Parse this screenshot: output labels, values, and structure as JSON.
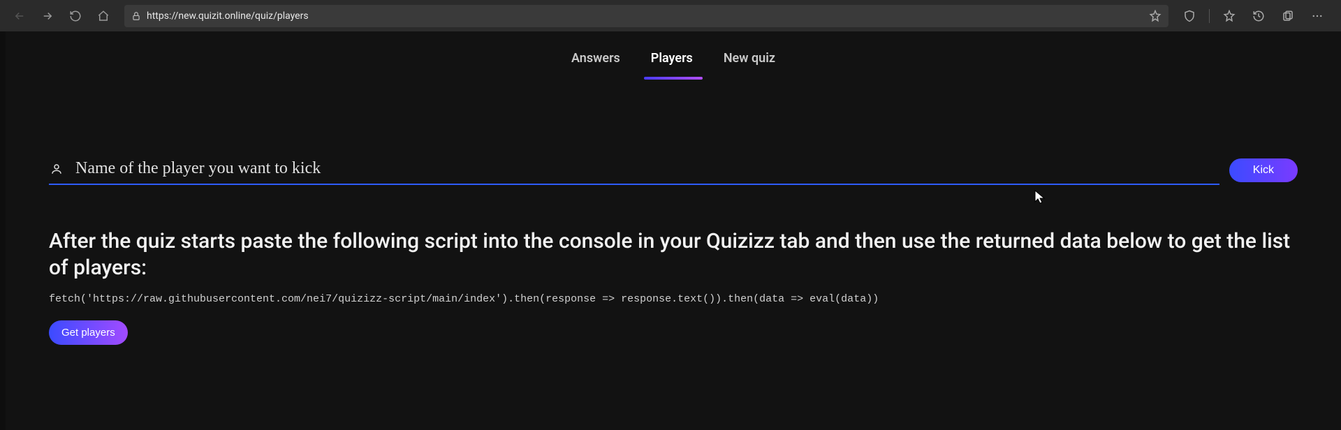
{
  "browser": {
    "url": "https://new.quizit.online/quiz/players"
  },
  "tabs": {
    "items": [
      {
        "label": "Answers"
      },
      {
        "label": "Players"
      },
      {
        "label": "New quiz"
      }
    ],
    "active_index": 1
  },
  "kick": {
    "placeholder": "Name of the player you want to kick",
    "button_label": "Kick"
  },
  "instructions": "After the quiz starts paste the following script into the console in your Quizizz tab and then use the returned data below to get the list of players:",
  "script_code": "fetch('https://raw.githubusercontent.com/nei7/quizizz-script/main/index').then(response => response.text()).then(data => eval(data))",
  "get_players_label": "Get players"
}
